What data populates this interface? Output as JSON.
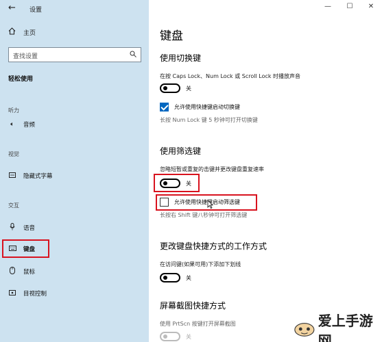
{
  "app": {
    "title": "设置"
  },
  "window_controls": {
    "minimize": "—",
    "maximize": "☐",
    "close": "✕"
  },
  "sidebar": {
    "back_icon": "back-arrow-icon",
    "home": {
      "icon": "home-icon",
      "label": "主页"
    },
    "search": {
      "placeholder": "查找设置",
      "icon": "search-icon"
    },
    "category": "轻松使用",
    "groups": [
      {
        "header": "听力",
        "items": [
          {
            "icon": "speaker-icon",
            "label": "音频"
          }
        ]
      },
      {
        "header": "视觉",
        "items": [
          {
            "icon": "closed-caption-icon",
            "label": "隐藏式字幕"
          }
        ]
      },
      {
        "header": "交互",
        "items": [
          {
            "icon": "microphone-icon",
            "label": "语音"
          },
          {
            "icon": "keyboard-icon",
            "label": "键盘",
            "active": true
          },
          {
            "icon": "mouse-icon",
            "label": "鼠标"
          },
          {
            "icon": "eye-control-icon",
            "label": "目视控制"
          }
        ]
      }
    ]
  },
  "main": {
    "title": "键盘",
    "sticky_keys": {
      "heading": "使用切换键",
      "description": "在按 Caps Lock、Num Lock 或 Scroll Lock 时播放声音",
      "toggle_state": "关",
      "checkbox_label": "允许使用快捷键启动切换键",
      "checkbox_checked": true,
      "hint": "长按 Num Lock 键 5 秒钟可打开切换键"
    },
    "filter_keys": {
      "heading": "使用筛选键",
      "description": "忽略短暂或重复的击键并更改键盘重复速率",
      "toggle_state": "关",
      "checkbox_label": "允许使用快捷键启动筛选键",
      "checkbox_checked": false,
      "hint": "长按右 Shift 键八秒钟可打开筛选键"
    },
    "shortcut_section": {
      "heading": "更改键盘快捷方式的工作方式",
      "description": "在访问键(如果可用)下添加下划线",
      "toggle_state": "关"
    },
    "screenshot_section": {
      "heading": "屏幕截图快捷方式",
      "description": "使用 PrtScn 按键打开屏幕截图",
      "toggle_state": "关"
    }
  },
  "watermark": {
    "text": "爱上手游网",
    "logo": "aishangshouyou-logo"
  },
  "colors": {
    "sidebar_bg": "#cde2f0",
    "accent": "#0067c0",
    "highlight": "#d8121e"
  }
}
